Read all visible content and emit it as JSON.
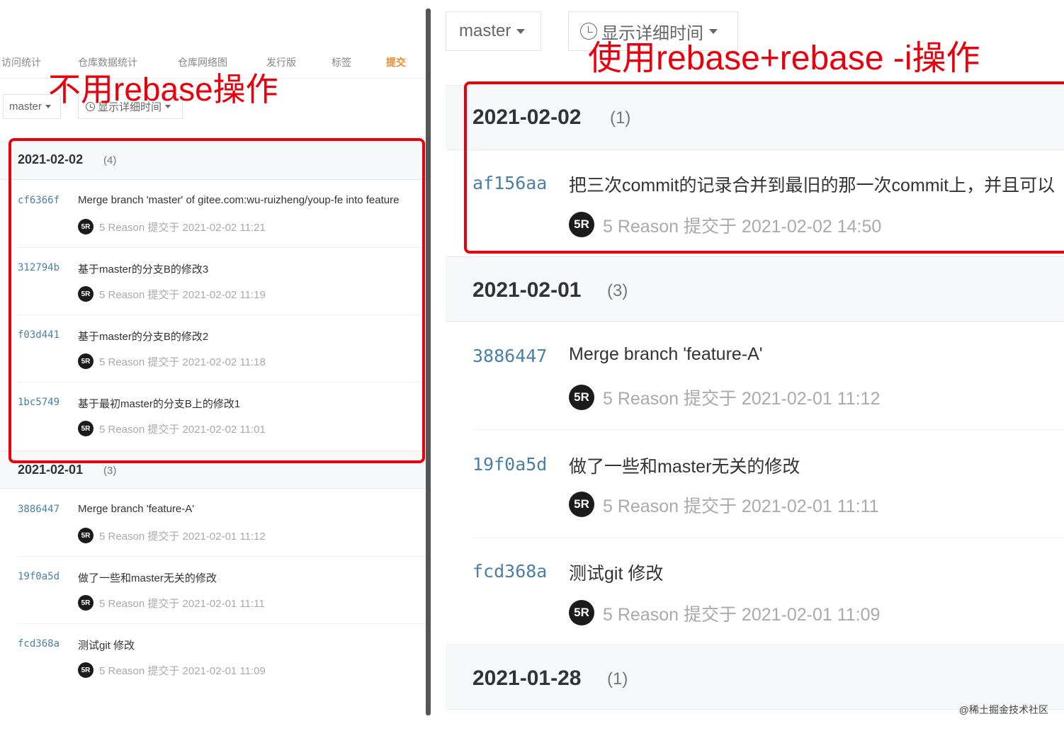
{
  "left": {
    "tabs": [
      {
        "label": "访问统计",
        "active": false
      },
      {
        "label": "仓库数据统计",
        "active": false
      },
      {
        "label": "仓库网络图",
        "active": false
      },
      {
        "label": "发行版",
        "active": false
      },
      {
        "label": "标签",
        "active": false
      },
      {
        "label": "提交",
        "active": true
      }
    ],
    "branch_label": "master",
    "detail_time_label": "显示详细时间",
    "annotation": "不用rebase操作",
    "groups": [
      {
        "date": "2021-02-02",
        "count": "(4)",
        "commits": [
          {
            "sha": "cf6366f",
            "message": "Merge branch 'master' of gitee.com:wu-ruizheng/youp-fe into feature",
            "avatar": "5R",
            "meta": "5 Reason 提交于 2021-02-02 11:21"
          },
          {
            "sha": "312794b",
            "message": "基于master的分支B的修改3",
            "avatar": "5R",
            "meta": "5 Reason 提交于 2021-02-02 11:19"
          },
          {
            "sha": "f03d441",
            "message": "基于master的分支B的修改2",
            "avatar": "5R",
            "meta": "5 Reason 提交于 2021-02-02 11:18"
          },
          {
            "sha": "1bc5749",
            "message": "基于最初master的分支B上的修改1",
            "avatar": "5R",
            "meta": "5 Reason 提交于 2021-02-02 11:01"
          }
        ]
      },
      {
        "date": "2021-02-01",
        "count": "(3)",
        "commits": [
          {
            "sha": "3886447",
            "message": "Merge branch 'feature-A'",
            "avatar": "5R",
            "meta": "5 Reason 提交于 2021-02-01 11:12"
          },
          {
            "sha": "19f0a5d",
            "message": "做了一些和master无关的修改",
            "avatar": "5R",
            "meta": "5 Reason 提交于 2021-02-01 11:11"
          },
          {
            "sha": "fcd368a",
            "message": "测试git 修改",
            "avatar": "5R",
            "meta": "5 Reason 提交于 2021-02-01 11:09"
          }
        ]
      }
    ]
  },
  "right": {
    "branch_label": "master",
    "detail_time_label": "显示详细时间",
    "annotation": "使用rebase+rebase -i操作",
    "groups": [
      {
        "date": "2021-02-02",
        "count": "(1)",
        "commits": [
          {
            "sha": "af156aa",
            "message": "把三次commit的记录合并到最旧的那一次commit上，并且可以",
            "avatar": "5R",
            "meta": "5 Reason 提交于 2021-02-02 14:50"
          }
        ]
      },
      {
        "date": "2021-02-01",
        "count": "(3)",
        "commits": [
          {
            "sha": "3886447",
            "message": "Merge branch 'feature-A'",
            "avatar": "5R",
            "meta": "5 Reason 提交于 2021-02-01 11:12"
          },
          {
            "sha": "19f0a5d",
            "message": "做了一些和master无关的修改",
            "avatar": "5R",
            "meta": "5 Reason 提交于 2021-02-01 11:11"
          },
          {
            "sha": "fcd368a",
            "message": "测试git 修改",
            "avatar": "5R",
            "meta": "5 Reason 提交于 2021-02-01 11:09"
          }
        ]
      },
      {
        "date": "2021-01-28",
        "count": "(1)",
        "commits": []
      }
    ]
  },
  "watermark": "@稀土掘金技术社区",
  "colors": {
    "annotation_red": "#e8000d",
    "active_tab": "#f0882b",
    "sha_blue": "#4a7fa8"
  }
}
